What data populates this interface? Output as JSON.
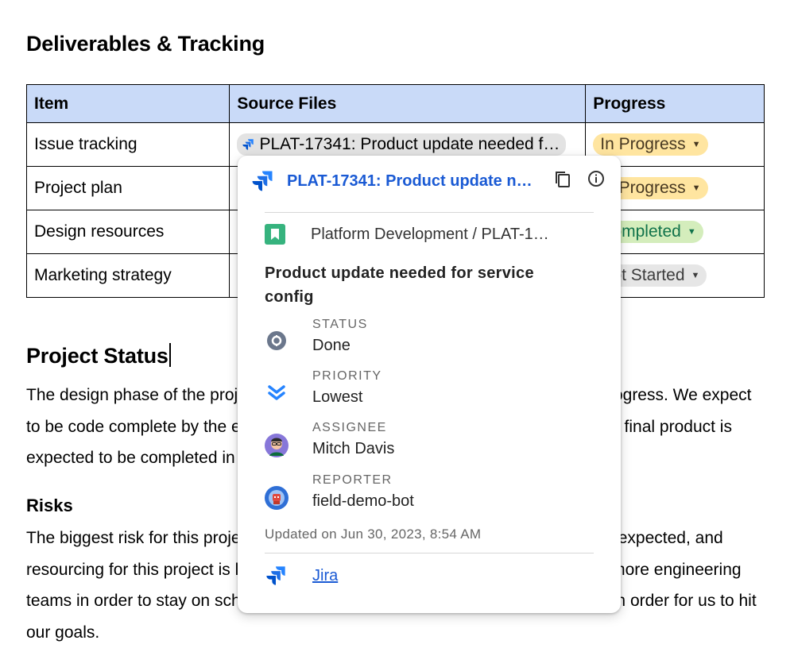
{
  "deliverables": {
    "title": "Deliverables & Tracking",
    "headers": [
      "Item",
      "Source Files",
      "Progress"
    ],
    "rows": [
      {
        "item": "Issue tracking",
        "file": "PLAT-17341: Product update needed f…",
        "status": "In Progress"
      },
      {
        "item": "Project plan",
        "file": "",
        "status": "In Progress"
      },
      {
        "item": "Design resources",
        "file": "",
        "status": "Completed"
      },
      {
        "item": "Marketing strategy",
        "file": "",
        "status": "Not Started"
      }
    ]
  },
  "project_status": {
    "title": "Project Status",
    "body": "The design phase of the project is complete and the development phase is in progress. We expect to be code complete by the end of next month, after which testing will begin. The final product is expected to be completed in the third quarter."
  },
  "risks": {
    "title": "Risks",
    "body": "The biggest risk for this project is that the development phase takes longer than expected, and resourcing for this project is limited. We will need to bring on board at least two more engineering teams in order to stay on schedule, and leadership must approve more funding in order for us to hit our goals."
  },
  "popup": {
    "title": "PLAT-17341: Product update n…",
    "project": "Platform Development / PLAT-1…",
    "summary": "Product update needed for service config",
    "fields": [
      {
        "label": "STATUS",
        "value": "Done",
        "icon": "status-icon"
      },
      {
        "label": "PRIORITY",
        "value": "Lowest",
        "icon": "priority-lowest-icon"
      },
      {
        "label": "ASSIGNEE",
        "value": "Mitch Davis",
        "icon": "assignee-avatar"
      },
      {
        "label": "REPORTER",
        "value": "field-demo-bot",
        "icon": "reporter-avatar"
      }
    ],
    "updated": "Updated on Jun 30, 2023, 8:54 AM",
    "source": "Jira"
  },
  "colors": {
    "header_bg": "#c9daf8",
    "in_progress": "#ffe5a0",
    "completed": "#d4edbc",
    "not_started": "#e6e6e6",
    "link": "#1a5ad4"
  }
}
